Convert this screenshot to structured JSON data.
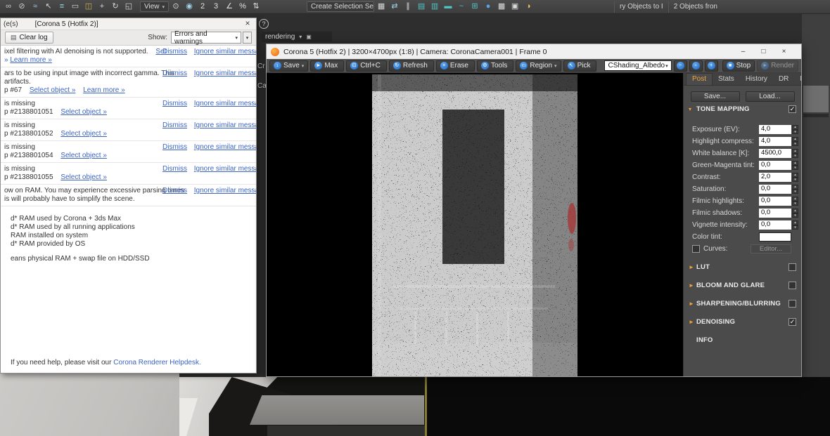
{
  "colors": {
    "corona_orange": "#e8861a",
    "accent_blue": "#1d66c0",
    "link_blue": "#3b63c4",
    "panel_gray": "#4b4b4b",
    "noise_red": "#a83232"
  },
  "glyphs": {
    "caret": "▾",
    "spin_up": "▴",
    "spin_down": "▾",
    "min": "–",
    "max_box": "□",
    "close": "×",
    "help": "?",
    "box": "▣"
  },
  "max_toolbar": {
    "icons_left": [
      {
        "name": "select-and-link-icon",
        "glyph": "∞",
        "c": "#c9c9c9"
      },
      {
        "name": "unlink-selection-icon",
        "glyph": "⊘",
        "c": "#c9c9c9"
      },
      {
        "name": "bind-to-space-warp-icon",
        "glyph": "≈",
        "c": "#9fd4e8"
      },
      {
        "name": "select-object-icon",
        "glyph": "↖",
        "c": "#d8d8d8"
      },
      {
        "name": "select-by-name-icon",
        "glyph": "≡",
        "c": "#9fd4e8"
      },
      {
        "name": "rectangular-selection-icon",
        "glyph": "▭",
        "c": "#d8d8d8"
      },
      {
        "name": "window-crossing-icon",
        "glyph": "◫",
        "c": "#c9b24a"
      },
      {
        "name": "select-and-move-icon",
        "glyph": "+",
        "c": "#d8d8d8"
      },
      {
        "name": "select-and-rotate-icon",
        "glyph": "↻",
        "c": "#d8d8d8"
      },
      {
        "name": "select-and-scale-icon",
        "glyph": "◱",
        "c": "#d8d8d8"
      }
    ],
    "view_dropdown": {
      "label": "View"
    },
    "icons_mid": [
      {
        "name": "use-pivot-center-icon",
        "glyph": "⊙",
        "c": "#d8d8d8"
      },
      {
        "name": "select-and-manipulate-icon",
        "glyph": "◉",
        "c": "#9fd4e8"
      },
      {
        "name": "snap-toggle-2d-icon",
        "glyph": "2",
        "c": "#e0e0e0"
      },
      {
        "name": "snap-toggle-3d-icon",
        "glyph": "3",
        "c": "#e0e0e0"
      },
      {
        "name": "angle-snap-icon",
        "glyph": "∠",
        "c": "#e0e0e0"
      },
      {
        "name": "percent-snap-icon",
        "glyph": "%",
        "c": "#e0e0e0"
      },
      {
        "name": "spinner-snap-icon",
        "glyph": "⇅",
        "c": "#e0e0e0"
      }
    ],
    "selection_set_field": {
      "value": "Create Selection Se"
    },
    "icons_right": [
      {
        "name": "edit-named-selection-sets-icon",
        "glyph": "▦",
        "c": "#d8d8d8"
      },
      {
        "name": "mirror-icon",
        "glyph": "⇄",
        "c": "#9fd4e8"
      },
      {
        "name": "align-icon",
        "glyph": "∥",
        "c": "#d8d8d8"
      },
      {
        "name": "toggle-scene-explorer-icon",
        "glyph": "▤",
        "c": "#4fc3c3"
      },
      {
        "name": "toggle-layer-explorer-icon",
        "glyph": "▥",
        "c": "#4fc3c3"
      },
      {
        "name": "toggle-ribbon-icon",
        "glyph": "▬",
        "c": "#4fc3c3"
      },
      {
        "name": "curve-editor-icon",
        "glyph": "~",
        "c": "#4fc3c3"
      },
      {
        "name": "schematic-view-icon",
        "glyph": "⊞",
        "c": "#4fc3c3"
      },
      {
        "name": "material-editor-icon",
        "glyph": "●",
        "c": "#5aa7e8"
      },
      {
        "name": "render-setup-icon",
        "glyph": "▩",
        "c": "#d8d8d8"
      },
      {
        "name": "rendered-frame-window-icon",
        "glyph": "▣",
        "c": "#d8d8d8"
      },
      {
        "name": "render-production-icon",
        "glyph": "◑",
        "c": "#e8c85a"
      }
    ],
    "right_labels": [
      "ry Objects to I",
      "2 Objects fron"
    ]
  },
  "fragments": {
    "rendering_label": "rendering",
    "left_fragment_1": "Cr",
    "left_fragment_2": "Ca"
  },
  "log_window": {
    "title_fragment": "(e(s)",
    "title": "[Corona 5 (Hotfix 2)]",
    "clear_log": "Clear log",
    "clear_icon": "▤",
    "show_label": "Show:",
    "filter_value": "Errors and warnings",
    "dismiss_label": "Dismiss",
    "ignore_label": "Ignore similar messages",
    "warning_ai": {
      "text": "ixel filtering with AI denoising is not supported.",
      "set_link": "Set",
      "more_prefix": "»",
      "more_link": "Learn more »"
    },
    "warning_gamma": {
      "line1": "ars to be using input image with incorrect gamma. This",
      "line2": "artifacts.",
      "ref": "p #67",
      "select_link": "Select object »",
      "more_link": "Learn more »"
    },
    "missing_maps": [
      {
        "line1": "is missing",
        "ref": "p #2138801051",
        "select_link": "Select object »"
      },
      {
        "line1": "is missing",
        "ref": "p #2138801052",
        "select_link": "Select object »"
      },
      {
        "line1": "is missing",
        "ref": "p #2138801054",
        "select_link": "Select object »"
      },
      {
        "line1": "is missing",
        "ref": "p #2138801055",
        "select_link": "Select object »"
      }
    ],
    "warning_ram": {
      "line1": "ow on RAM. You may experience excessive parsing times",
      "line2": "is will probably have to simplify the scene."
    },
    "ram_info": [
      "d* RAM used by Corona + 3ds Max",
      "d* RAM used by all running applications",
      "RAM installed on system",
      "d* RAM provided by OS"
    ],
    "ram_note": "eans physical RAM + swap file on HDD/SSD",
    "footer_text": "If you need help, please visit our",
    "footer_link": "Corona Renderer Helpdesk."
  },
  "vfb": {
    "title": "Corona 5 (Hotfix 2) | 3200×4700px (1:8) | Camera: CoronaCamera001 | Frame 0",
    "toolbar": [
      {
        "name": "save-button",
        "label": "Save",
        "glyph": "↓",
        "caret": "▾"
      },
      {
        "name": "max-button",
        "label": "Max",
        "glyph": "►",
        "caret": ""
      },
      {
        "name": "copy-button",
        "label": "Ctrl+C",
        "glyph": "⊡",
        "caret": ""
      },
      {
        "name": "refresh-button",
        "label": "Refresh",
        "glyph": "↻",
        "caret": ""
      },
      {
        "name": "erase-button",
        "label": "Erase",
        "glyph": "×",
        "caret": ""
      },
      {
        "name": "tools-button",
        "label": "Tools",
        "glyph": "⚙",
        "caret": ""
      },
      {
        "name": "region-button",
        "label": "Region",
        "glyph": "▭",
        "caret": "▾"
      },
      {
        "name": "pick-button",
        "label": "Pick",
        "glyph": "↖",
        "caret": ""
      }
    ],
    "channel_dropdown": {
      "value": "CShading_Albedo"
    },
    "zoom_buttons": [
      {
        "name": "zoom-out-button",
        "glyph": "−"
      },
      {
        "name": "zoom-reset-button",
        "glyph": "▫"
      },
      {
        "name": "zoom-in-button",
        "glyph": "+"
      }
    ],
    "stop_button": {
      "label": "Stop",
      "glyph": "■"
    },
    "render_button": {
      "label": "Render",
      "glyph": "►"
    },
    "panel": {
      "tabs": [
        {
          "name": "tab-post",
          "label": "Post",
          "cls": "vtab active"
        },
        {
          "name": "tab-stats",
          "label": "Stats",
          "cls": "vtab"
        },
        {
          "name": "tab-history",
          "label": "History",
          "cls": "vtab"
        },
        {
          "name": "tab-dr",
          "label": "DR",
          "cls": "vtab"
        },
        {
          "name": "tab-lightmix",
          "label": "LightMix",
          "cls": "vtab"
        }
      ],
      "save_button": "Save...",
      "load_button": "Load...",
      "tone_mapping": {
        "arrow": "▾",
        "label": "TONE MAPPING",
        "check": "✓"
      },
      "tm_rows": [
        {
          "label": "Exposure (EV):",
          "value": "4,0"
        },
        {
          "label": "Highlight compress:",
          "value": "4,0"
        },
        {
          "label": "White balance [K]:",
          "value": "4500,0"
        },
        {
          "label": "Green-Magenta tint:",
          "value": "0,0"
        },
        {
          "label": "Contrast:",
          "value": "2,0"
        },
        {
          "label": "Saturation:",
          "value": "0,0"
        },
        {
          "label": "Filmic highlights:",
          "value": "0,0"
        },
        {
          "label": "Filmic shadows:",
          "value": "0,0"
        },
        {
          "label": "Vignette intensity:",
          "value": "0,0"
        }
      ],
      "color_tint_label": "Color tint:",
      "curves_label": "Curves:",
      "editor_button": "Editor...",
      "sections": [
        {
          "arrow": "►",
          "label": "LUT",
          "check": ""
        },
        {
          "arrow": "►",
          "label": "BLOOM AND GLARE",
          "check": ""
        },
        {
          "arrow": "►",
          "label": "SHARPENING/BLURRING",
          "check": ""
        },
        {
          "arrow": "►",
          "label": "DENOISING",
          "check": "✓"
        }
      ],
      "info_label": "INFO"
    }
  }
}
